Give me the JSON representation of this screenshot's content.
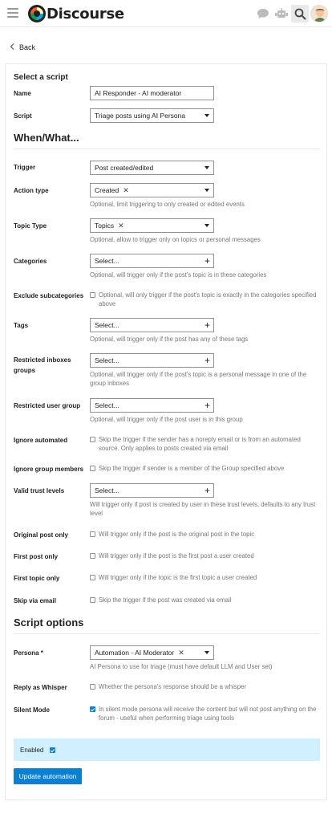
{
  "header": {
    "logo_text": "Discourse"
  },
  "nav": {
    "back_label": "Back"
  },
  "form": {
    "select_script_heading": "Select a script",
    "name_label": "Name",
    "name_value": "AI Responder - AI moderator",
    "script_label": "Script",
    "script_value": "Triage posts using AI Persona",
    "when_heading": "When/What...",
    "trigger_label": "Trigger",
    "trigger_value": "Post created/edited",
    "action_type_label": "Action type",
    "action_type_value": "Created",
    "action_type_help": "Optional, limit triggering to only created or edited events",
    "topic_type_label": "Topic Type",
    "topic_type_value": "Topics",
    "topic_type_help": "Optional, allow to trigger only on topics or personal messages",
    "categories_label": "Categories",
    "categories_value": "Select...",
    "categories_help": "Optional, will trigger only if the post's topic is in these categories",
    "exclude_sub_label": "Exclude subcategories",
    "exclude_sub_help": "Optional, will only trigger if the post's topic is exactly in the categories specified above",
    "tags_label": "Tags",
    "tags_value": "Select...",
    "tags_help": "Optional, will trigger only if the post has any of these tags",
    "restricted_inboxes_label": "Restricted inboxes groups",
    "restricted_inboxes_value": "Select...",
    "restricted_inboxes_help": "Optional, will trigger only if the post's topic is a personal message in one of the group inboxes",
    "restricted_user_group_label": "Restricted user group",
    "restricted_user_group_value": "Select...",
    "restricted_user_group_help": "Optional, will trigger only if the post user is in this group",
    "ignore_automated_label": "Ignore automated",
    "ignore_automated_help": "Skip the trigger if the sender has a noreply email or is from an automated source. Only applies to posts created via email",
    "ignore_group_members_label": "Ignore group members",
    "ignore_group_members_help": "Skip the trigger if sender is a member of the Group specified above",
    "valid_trust_label": "Valid trust levels",
    "valid_trust_value": "Select...",
    "valid_trust_help": "Will trigger only if post is created by user in these trust levels, defaults to any trust level",
    "original_post_label": "Original post only",
    "original_post_help": "Will trigger only if the post is the original post in the topic",
    "first_post_label": "First post only",
    "first_post_help": "Will trigger only if the post is the first post a user created",
    "first_topic_label": "First topic only",
    "first_topic_help": "Will trigger only if the topic is the first topic a user created",
    "skip_email_label": "Skip via email",
    "skip_email_help": "Skip the trigger if the post was created via email",
    "script_options_heading": "Script options",
    "persona_label": "Persona *",
    "persona_value": "Automation - AI Moderator",
    "persona_help": "AI Persona to use for triage (must have default LLM and User set)",
    "whisper_label": "Reply as Whisper",
    "whisper_help": "Whether the persona's response should be a whisper",
    "silent_label": "Silent Mode",
    "silent_help": "In silent mode persona will receive the content but will not post anything on the forum - useful when performing triage using tools",
    "enabled_label": "Enabled",
    "update_button": "Update automation"
  },
  "colors": {
    "primary": "#0a7fd6",
    "highlight": "#d1f0ff"
  },
  "state": {
    "silent_mode": true,
    "enabled": true
  }
}
